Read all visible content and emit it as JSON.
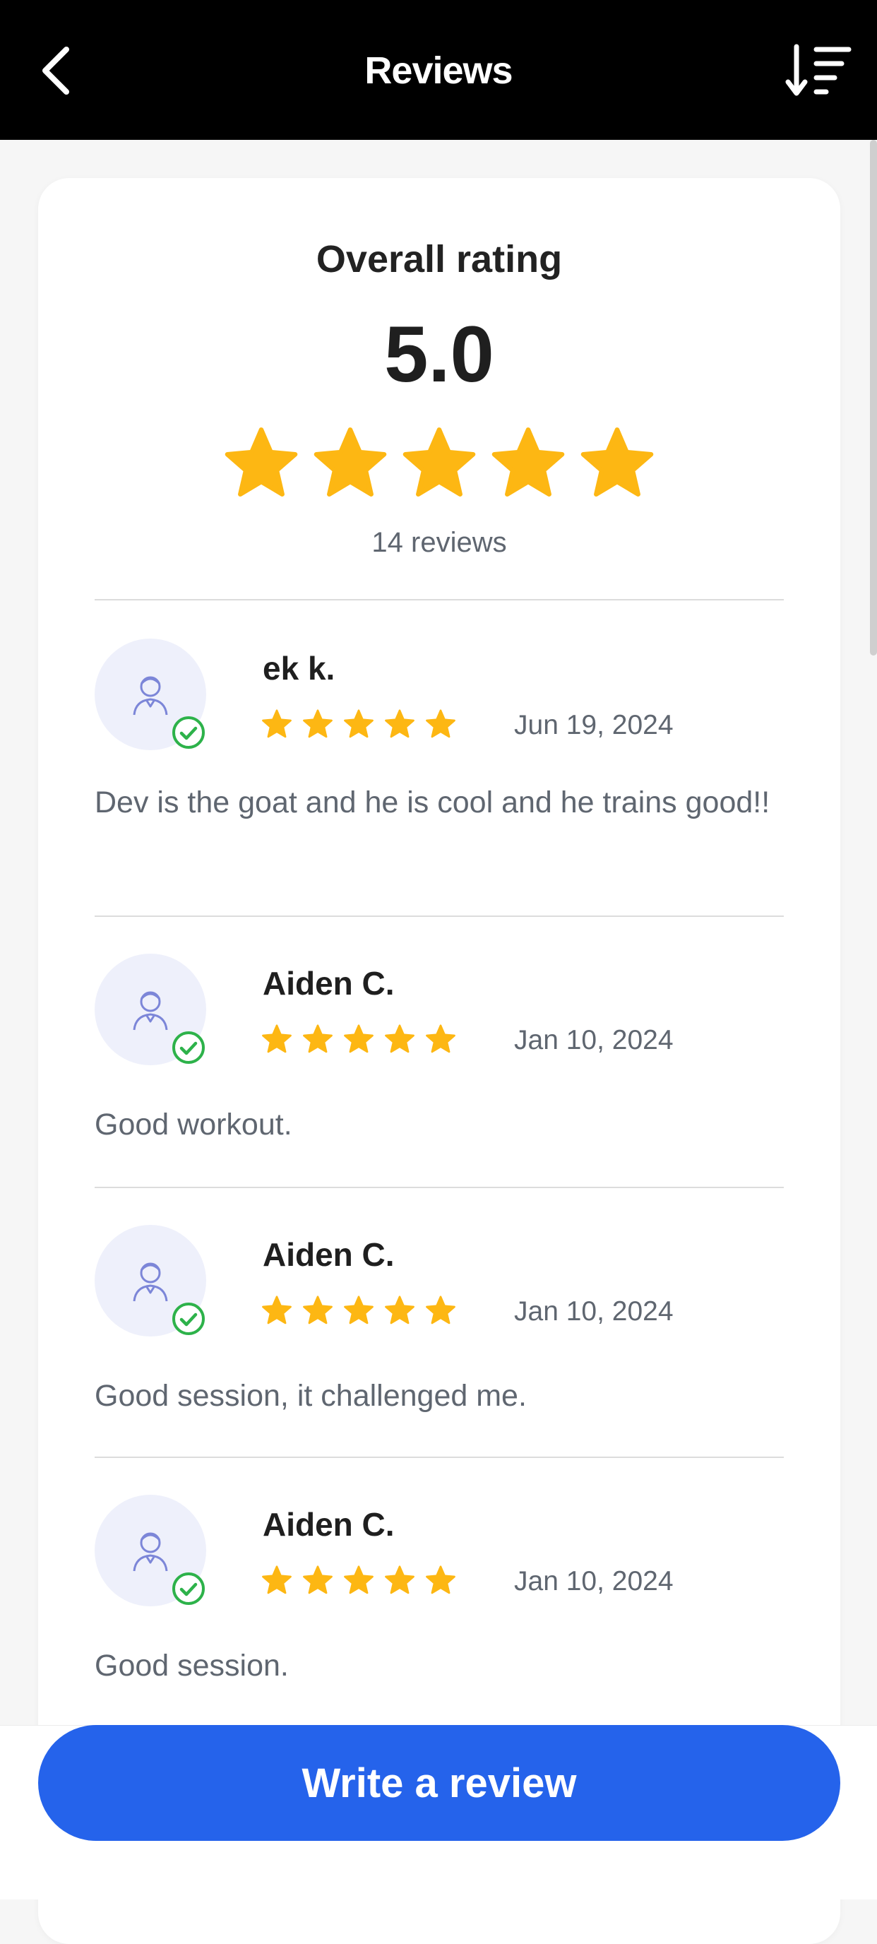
{
  "header": {
    "title": "Reviews",
    "back_icon": "chevron-left-icon",
    "sort_icon": "sort-descending-icon"
  },
  "colors": {
    "star": "#FDB713",
    "accent": "#2563EB",
    "verified": "#2DB24A",
    "avatar_bg": "#EEF0FB",
    "avatar_line": "#7C86D8"
  },
  "overall": {
    "title": "Overall rating",
    "score": "5.0",
    "stars": 5,
    "count_label": "14 reviews"
  },
  "reviews": [
    {
      "name": "ek k.",
      "rating": 5,
      "date": "Jun 19, 2024",
      "text": "Dev is the goat and he is cool and he trains good!!"
    },
    {
      "name": "Aiden C.",
      "rating": 5,
      "date": "Jan 10, 2024",
      "text": "Good workout."
    },
    {
      "name": "Aiden C.",
      "rating": 5,
      "date": "Jan 10, 2024",
      "text": "Good session, it challenged me."
    },
    {
      "name": "Aiden C.",
      "rating": 5,
      "date": "Jan 10, 2024",
      "text": "Good session."
    }
  ],
  "cta": {
    "label": "Write a review"
  }
}
